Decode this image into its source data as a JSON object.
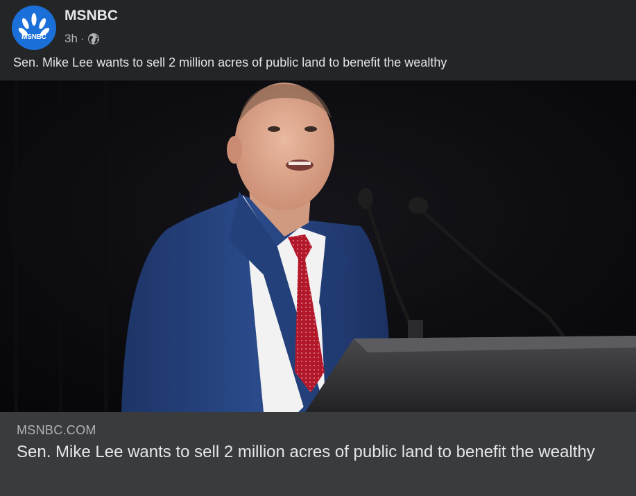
{
  "post": {
    "page_name": "MSNBC",
    "avatar_text": "MSNBC",
    "time": "3h",
    "separator": "·",
    "privacy_icon": "globe-icon",
    "caption": "Sen. Mike Lee wants to sell 2 million acres of public land to benefit the wealthy"
  },
  "link_preview": {
    "domain": "MSNBC.COM",
    "title": "Sen. Mike Lee wants to sell 2 million acres of public land to benefit the wealthy"
  },
  "colors": {
    "background": "#242526",
    "preview_bg": "#3a3b3c",
    "brand_blue": "#1b6fd8",
    "primary_text": "#e4e6eb",
    "secondary_text": "#b0b3b8"
  }
}
